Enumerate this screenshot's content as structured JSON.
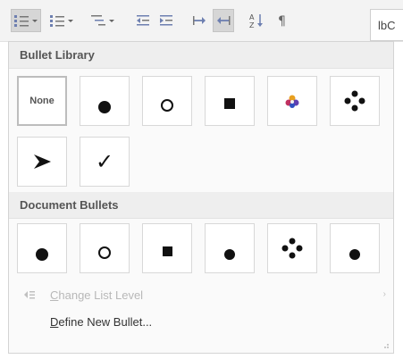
{
  "ribbon": {
    "style_preview": "lbC"
  },
  "library": {
    "header": "Bullet Library",
    "items": [
      {
        "type": "text",
        "label": "None",
        "selected": true
      },
      {
        "type": "dot"
      },
      {
        "type": "circle"
      },
      {
        "type": "square"
      },
      {
        "type": "flower"
      },
      {
        "type": "diamond-dots"
      },
      {
        "type": "arrow"
      },
      {
        "type": "check",
        "glyph": "✓"
      }
    ]
  },
  "document": {
    "header": "Document Bullets",
    "items": [
      {
        "type": "dot"
      },
      {
        "type": "circle"
      },
      {
        "type": "square"
      },
      {
        "type": "dot"
      },
      {
        "type": "diamond-dots"
      },
      {
        "type": "dot"
      }
    ]
  },
  "menu": {
    "change_level": {
      "label": "Change List Level",
      "accel_char": "C",
      "rest": "hange List Level",
      "disabled": true
    },
    "define_new": {
      "label": "Define New Bullet...",
      "accel_char": "D",
      "rest": "efine New Bullet..."
    }
  },
  "colors": {
    "panel_bg": "#fafafa",
    "header_bg": "#eeeeee",
    "tile_border": "#d8d8d8",
    "disabled_text": "#b8b8b8"
  }
}
